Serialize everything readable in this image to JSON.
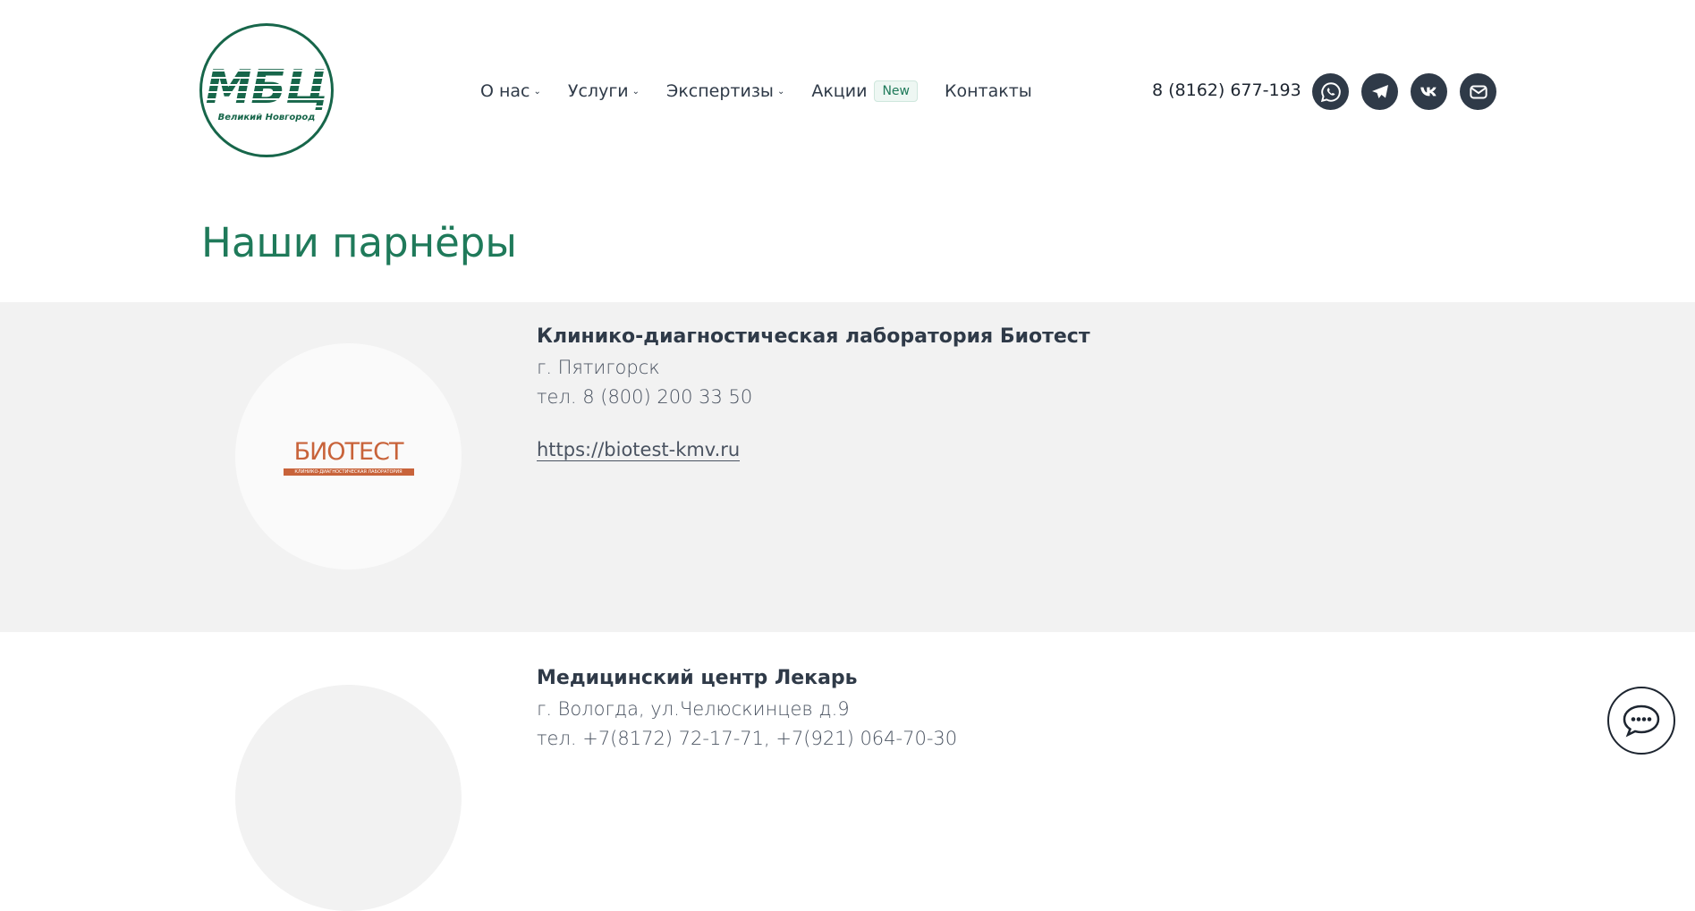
{
  "logo": {
    "mark": "МБЦ",
    "subtitle": "Великий Новгород"
  },
  "nav": [
    {
      "label": "О нас",
      "has_dropdown": true
    },
    {
      "label": "Услуги",
      "has_dropdown": true
    },
    {
      "label": "Экспертизы",
      "has_dropdown": true
    },
    {
      "label": "Акции",
      "badge": "New"
    },
    {
      "label": "Контакты"
    }
  ],
  "phone": "8 (8162) 677-193",
  "social_icons": [
    "whatsapp-icon",
    "telegram-icon",
    "vk-icon",
    "mail-icon"
  ],
  "page_title": "Наши парнёры",
  "partners": [
    {
      "logo_text": "БИОТЕСТ",
      "logo_caption": "КЛИНИКО-ДИАГНОСТИЧЕСКАЯ ЛАБОРАТОРИЯ",
      "name": "Клинико-диагностическая лаборатория Биотест",
      "city": "г. Пятигорск",
      "phone": "тел. 8 (800) 200 33 50",
      "link": "https://biotest-kmv.ru"
    },
    {
      "name": "Медицинский центр Лекарь",
      "city": "г. Вологда, ул.Челюскинцев д.9",
      "phone": "тел. +7(8172) 72-17-71, +7(921) 064-70-30"
    }
  ],
  "colors": {
    "brand": "#17664a",
    "title": "#1f7a5a",
    "dark": "#2f3a48",
    "band": "#f2f2f2",
    "biotest": "#c8633a"
  }
}
